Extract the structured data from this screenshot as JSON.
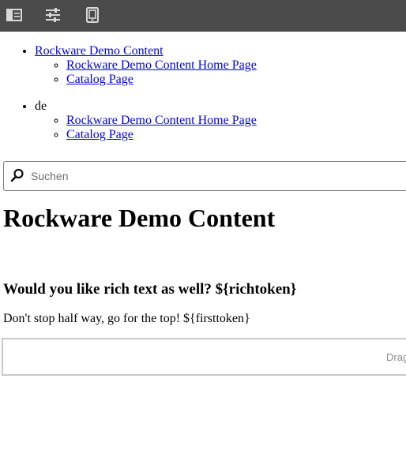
{
  "toolbar": {
    "buttons": [
      {
        "icon": "side-panel-icon"
      },
      {
        "icon": "properties-sliders-icon"
      },
      {
        "icon": "emulator-devices-icon"
      }
    ]
  },
  "nav": {
    "groups": [
      {
        "label": "Rockware Demo Content",
        "is_link": true,
        "children": [
          {
            "label": "Rockware Demo Content Home Page"
          },
          {
            "label": "Catalog Page"
          }
        ]
      },
      {
        "label": "de",
        "is_link": false,
        "children": [
          {
            "label": "Rockware Demo Content Home Page"
          },
          {
            "label": "Catalog Page"
          }
        ]
      }
    ]
  },
  "search": {
    "placeholder": "Suchen",
    "value": ""
  },
  "content": {
    "title": "Rockware Demo Content",
    "subheading": "Would you like rich text as well? ${richtoken}",
    "paragraph": "Don't stop half way, go for the top! ${firsttoken}",
    "dropzone_label": "Drag"
  },
  "colors": {
    "toolbar_bg": "#4b4b4b",
    "toolbar_icon": "#d8d8d8",
    "link": "#0000ee",
    "dropzone_border": "#c9c9c9"
  }
}
